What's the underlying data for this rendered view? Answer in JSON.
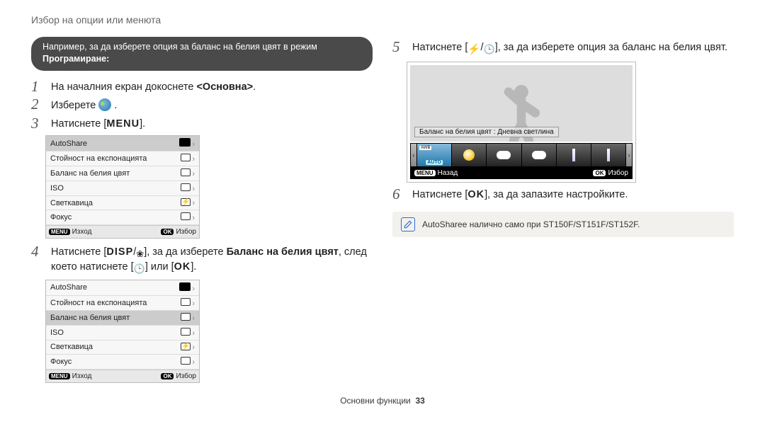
{
  "header": {
    "breadcrumb": "Избор на опции или менюта"
  },
  "example_pill": {
    "prefix": "Например, за да изберете опция за баланс на белия цвят в режим ",
    "bold": "Програмиране:"
  },
  "steps_left": {
    "s1": {
      "num": "1",
      "pre": "На началния екран докоснете ",
      "bold": "<Основна>",
      "post": "."
    },
    "s2": {
      "num": "2",
      "pre": "Изберете ",
      "post": "."
    },
    "s3": {
      "num": "3",
      "pre": "Натиснете [",
      "key": "MENU",
      "post": "]."
    },
    "s4": {
      "num": "4",
      "pre": "Натиснете [",
      "keyA": "DISP",
      "mid1": "/",
      "keyB_glyph": "flower",
      "mid2": "], за да изберете ",
      "bold": "Баланс на белия цвят",
      "mid3": ", след което натиснете [",
      "keyC_glyph": "timer",
      "mid4": "] или [",
      "keyD": "OK",
      "post": "]."
    }
  },
  "steps_right": {
    "s5": {
      "num": "5",
      "pre": "Натиснете [",
      "keyA_glyph": "flash",
      "mid1": "/",
      "keyB_glyph": "timer",
      "mid2": "], за да изберете опция за баланс на белия цвят."
    },
    "s6": {
      "num": "6",
      "pre": "Натиснете [",
      "key": "OK",
      "post": "], за да запазите настройките."
    }
  },
  "cam_menu": {
    "items": [
      {
        "label": "AutoShare",
        "icon": "globe"
      },
      {
        "label": "Стойност на експонацията",
        "icon": "exposure"
      },
      {
        "label": "Баланс на белия цвят",
        "icon": "wb"
      },
      {
        "label": "ISO",
        "icon": "iso"
      },
      {
        "label": "Светкавица",
        "icon": "flash"
      },
      {
        "label": "Фокус",
        "icon": "focus"
      }
    ],
    "footer_left_key": "MENU",
    "footer_left_text": "Изход",
    "footer_right_key": "OK",
    "footer_right_text": "Избор",
    "selected_index_step3": 0,
    "selected_index_step4": 2
  },
  "wb_preview": {
    "caption": "Баланс на белия цвят : Дневна светлина",
    "strip_items": [
      "auto",
      "sun",
      "cloud",
      "cloud2",
      "lamp",
      "lamp2"
    ],
    "footer_left_key": "MENU",
    "footer_left_text": "Назад",
    "footer_right_key": "OK",
    "footer_right_text": "Избор"
  },
  "note": {
    "text": "AutoSharee налично само при ST150F/ST151F/ST152F."
  },
  "footer": {
    "section": "Основни функции",
    "page_number": "33"
  }
}
